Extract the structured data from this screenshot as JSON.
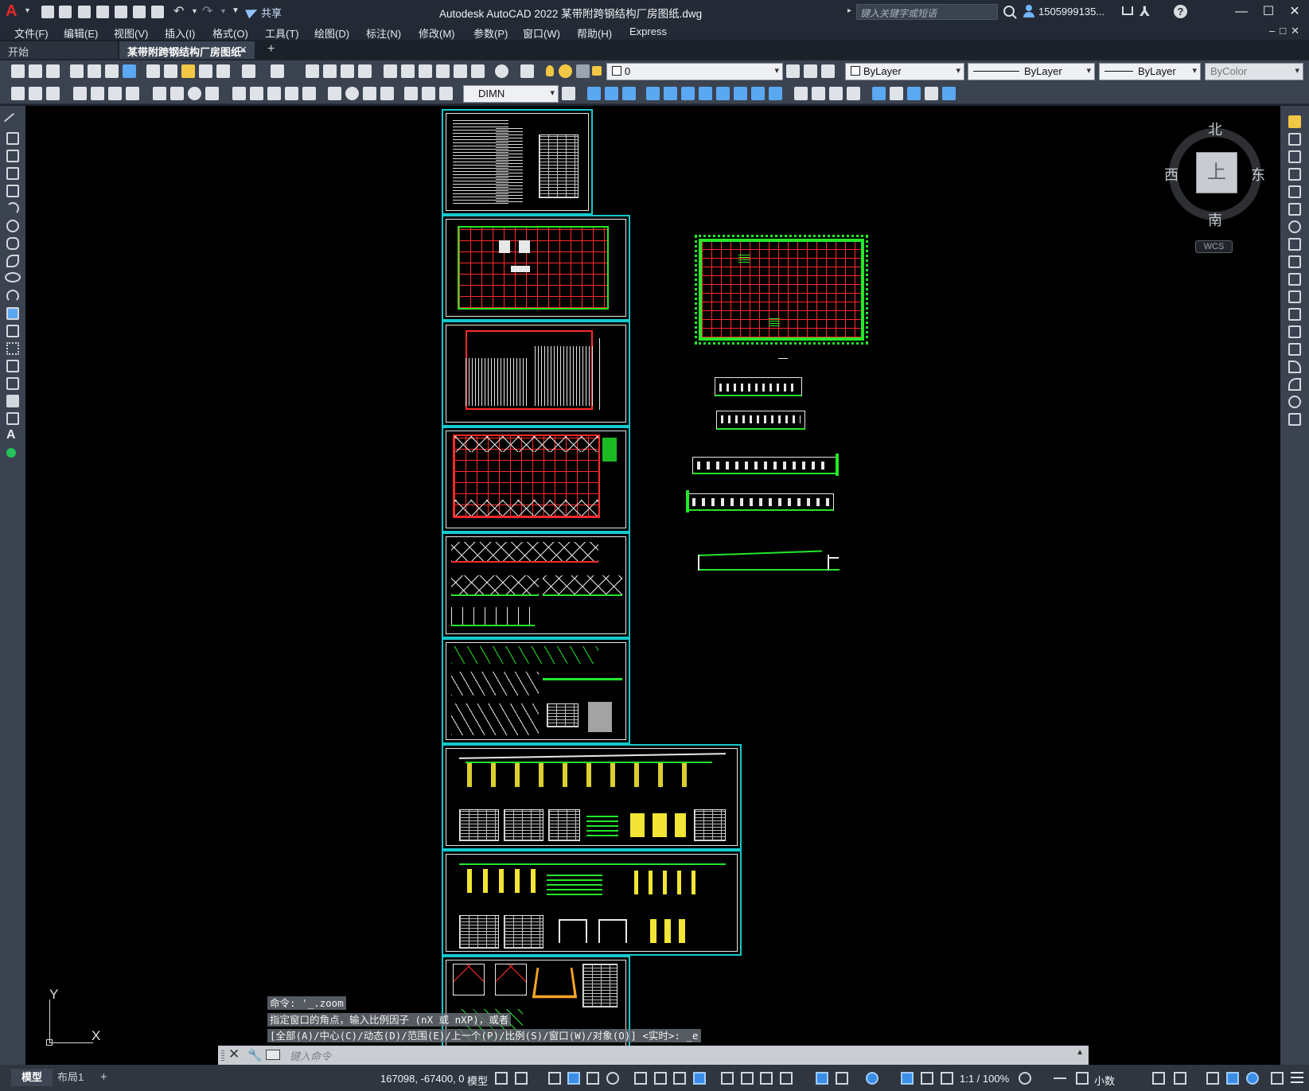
{
  "titlebar": {
    "app_logo": "A",
    "share_label": "共享",
    "window_title": "Autodesk AutoCAD 2022    某带附跨钢结构厂房图纸.dwg",
    "search_placeholder": "键入关键字或短语",
    "user_name": "1505999135...",
    "help_symbol": "?",
    "minimize": "—",
    "maximize": "☐",
    "close": "✕"
  },
  "menu": {
    "items": [
      "文件(F)",
      "编辑(E)",
      "视图(V)",
      "插入(I)",
      "格式(O)",
      "工具(T)",
      "绘图(D)",
      "标注(N)",
      "修改(M)",
      "参数(P)",
      "窗口(W)",
      "帮助(H)",
      "Express"
    ],
    "doc_controls": "–□✕"
  },
  "tabs": {
    "start": "开始",
    "document": "某带附跨钢结构厂房图纸*",
    "close": "✕",
    "new": "+"
  },
  "properties": {
    "layer": "0",
    "color": "ByLayer",
    "linetype": "ByLayer",
    "lineweight": "ByLayer",
    "plotstyle": "ByColor"
  },
  "dimstyle": {
    "value": "DIMN"
  },
  "viewcube": {
    "north": "北",
    "south": "南",
    "east": "东",
    "west": "西",
    "face": "上",
    "wcs": "WCS"
  },
  "ucs": {
    "y": "Y",
    "x": "X"
  },
  "command": {
    "history": [
      "命令: '_.zoom",
      "指定窗口的角点，输入比例因子 (nX 或 nXP)，或者",
      "[全部(A)/中心(C)/动态(D)/范围(E)/上一个(P)/比例(S)/窗口(W)/对象(O)] <实时>: _e"
    ],
    "placeholder": "键入命令"
  },
  "status": {
    "layout_tabs": [
      "模型",
      "布局1"
    ],
    "add_tab": "+",
    "coordinates": "167098, -67400, 0",
    "space": "模型",
    "annotation_scale": "1:1 / 100%",
    "units": "小数"
  },
  "colors": {
    "canvas": "#000000",
    "sheet_frame": "#15c9cf",
    "grid_red": "#ff2a2a",
    "column_green": "#23e82a",
    "ui_dark": "#232a35",
    "toolbar": "#3b4350"
  }
}
